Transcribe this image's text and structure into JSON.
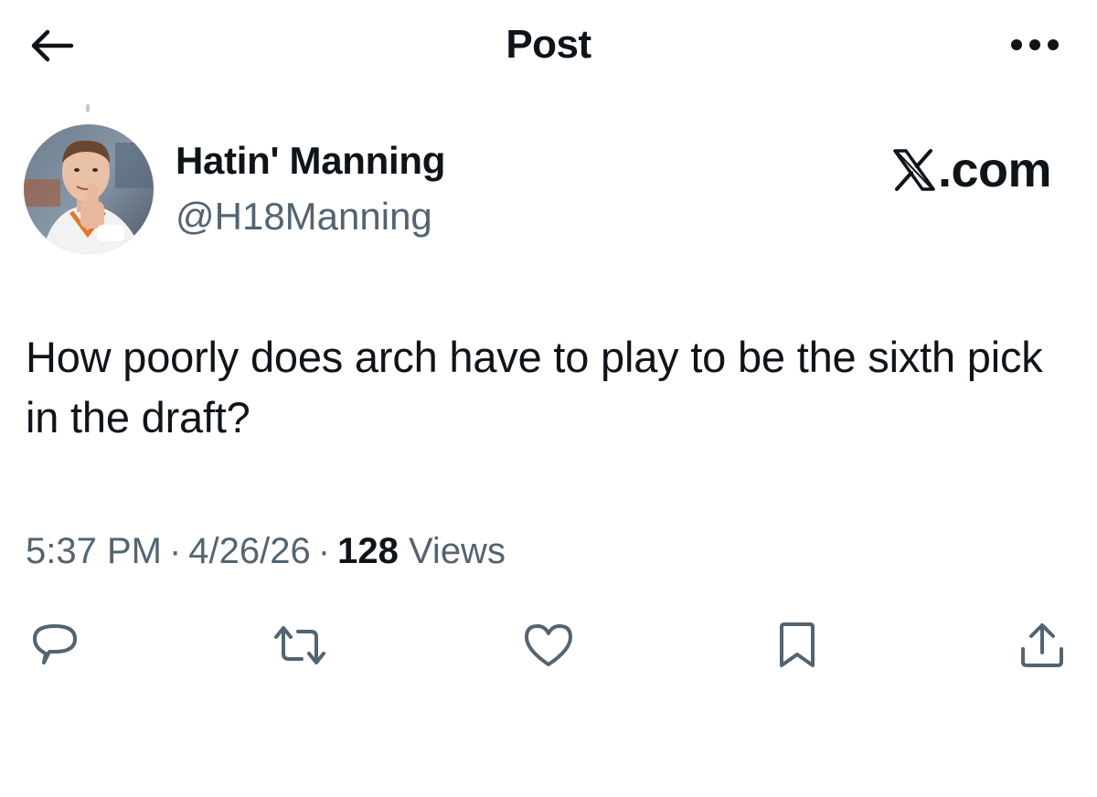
{
  "header": {
    "title": "Post",
    "back_icon": "arrow-left-icon",
    "more_icon": "more-horizontal-icon"
  },
  "author": {
    "display_name": "Hatin' Manning",
    "handle": "@H18Manning",
    "avatar_icon": "profile-photo"
  },
  "brand": {
    "text": ".com",
    "logo_icon": "x-logo-icon"
  },
  "tweet": {
    "text": "How poorly does arch have to play to be the sixth pick in the draft?"
  },
  "meta": {
    "time": "5:37 PM",
    "separator": "·",
    "date": "4/26/26",
    "views_count": "128",
    "views_label": "Views"
  },
  "actions": {
    "reply_icon": "reply-icon",
    "retweet_icon": "retweet-icon",
    "like_icon": "heart-icon",
    "bookmark_icon": "bookmark-icon",
    "share_icon": "share-icon"
  },
  "colors": {
    "text_primary": "#0f1419",
    "text_secondary": "#536471",
    "background": "#ffffff"
  }
}
